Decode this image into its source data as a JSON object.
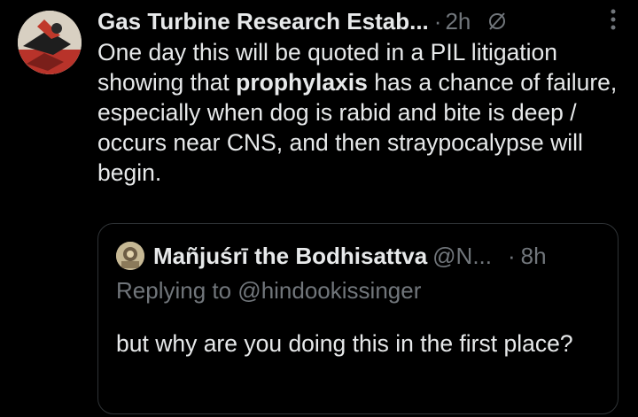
{
  "post": {
    "author_name": "Gas Turbine Research Estab...",
    "time": "2h",
    "separator": "·",
    "text_before": "One day this will be quoted in a PIL litigation showing that ",
    "text_highlight": "prophylaxis",
    "text_after": " has a chance of failure, especially when dog is rabid and bite is deep / occurs near CNS, and then straypocalypse will begin."
  },
  "quoted_post": {
    "author_name": "Mañjuśrī the Bodhisattva",
    "handle": "@N...",
    "separator": "·",
    "time": "8h",
    "replying_to": "Replying to @hindookissinger",
    "text": "but why are you doing this in the first place?"
  },
  "icons": {
    "grok": "grok-icon",
    "more": "more-options-icon"
  },
  "colors": {
    "background": "#000000",
    "text": "#e7e9ea",
    "muted": "#71767b",
    "border": "#2f3336"
  }
}
